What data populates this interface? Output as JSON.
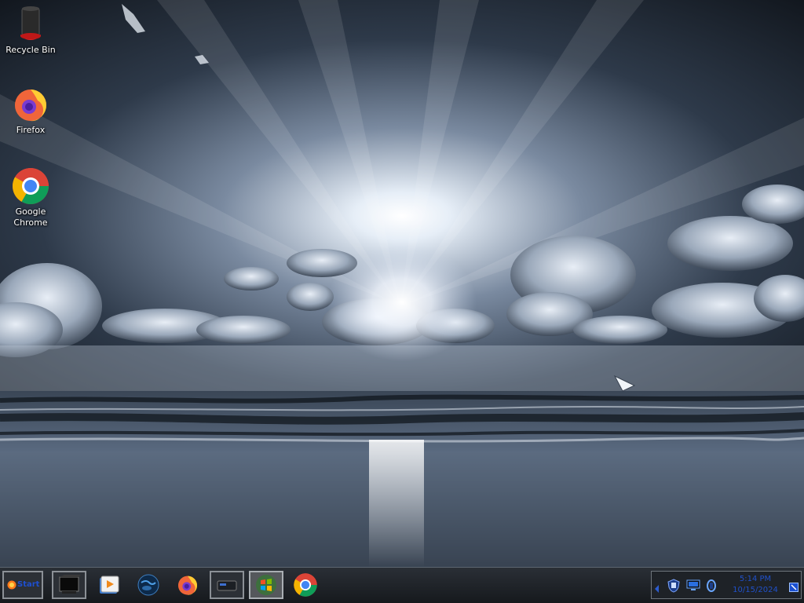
{
  "desktop": {
    "icons": [
      {
        "label": "Recycle Bin",
        "icon": "recycle-bin-icon"
      },
      {
        "label": "Firefox",
        "icon": "firefox-icon"
      },
      {
        "label": "Google\nChrome",
        "icon": "chrome-icon"
      }
    ]
  },
  "taskbar": {
    "start_label": "Start",
    "items": [
      {
        "icon": "terminal-icon",
        "active": false
      },
      {
        "icon": "media-player-icon",
        "active": false
      },
      {
        "icon": "globe-browser-icon",
        "active": false
      },
      {
        "icon": "firefox-icon",
        "active": false
      },
      {
        "icon": "drive-icon",
        "active": false
      },
      {
        "icon": "windows-flag-icon",
        "active": true
      },
      {
        "icon": "chrome-icon",
        "active": false
      }
    ],
    "tray": {
      "icons": [
        "tray-expand-icon",
        "security-shield-icon",
        "network-monitor-icon",
        "volume-icon",
        "show-desktop-icon"
      ],
      "clock_time": "5:14 PM",
      "clock_date": "10/15/2024"
    }
  },
  "colors": {
    "taskbar_bg": "#1f2328",
    "clock_text": "#2050c8",
    "icon_label": "#ffffff"
  }
}
